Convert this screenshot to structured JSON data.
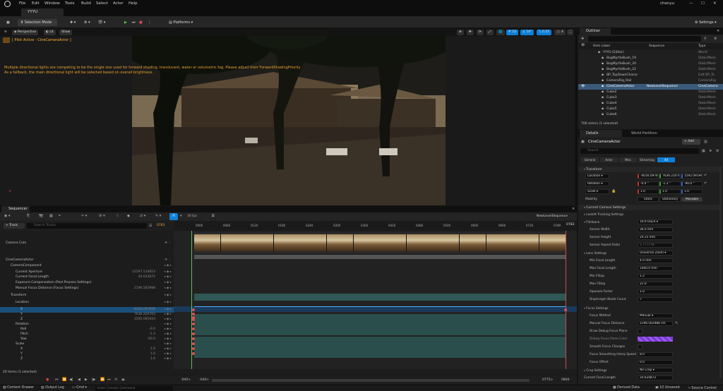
{
  "menubar": {
    "items": [
      "File",
      "Edit",
      "Window",
      "Tools",
      "Build",
      "Select",
      "Actor",
      "Help"
    ],
    "user": "chenyu",
    "project_tab": "YYYU"
  },
  "toolbar": {
    "selection_mode": "Selection Mode",
    "platforms": "Platforms",
    "settings": "Settings"
  },
  "viewport": {
    "perspective": "Perspective",
    "lit": "Lit",
    "show": "Show",
    "pilot_label": "[ Pilot Active - CineCameraActor ]",
    "warning_text": "Multiple directional lights are competing to be the single one used for forward shading, translucent, water or volumetric fog. Please adjust their ForwardShadingPriority",
    "fallback_text": "As a fallback, the main directional light will be selected based on overall brightness.",
    "snap_grid": "10",
    "snap_rot": "10°",
    "snap_scale": "0.25",
    "cam_speed": "4"
  },
  "sequencer": {
    "tab": "Sequencer",
    "track_button": "+ Track",
    "search_placeholder": "Search Tracks",
    "current_frame": "0783",
    "fps": "30 fps",
    "sequence_name": "NewLevelSequence",
    "sequence_frame": "0783",
    "rows": [
      {
        "label": "Camera Cuts",
        "indent": 0,
        "value": ""
      },
      {
        "label": "CineCameraActor",
        "indent": 0,
        "value": ""
      },
      {
        "label": "CameraComponent",
        "indent": 1,
        "value": ""
      },
      {
        "label": "Current Aperture",
        "indent": 2,
        "value": "12597.516853"
      },
      {
        "label": "Current Focal Length",
        "indent": 2,
        "value": "20.624872"
      },
      {
        "label": "Exposure Compensation (Post Process Settings)",
        "indent": 2,
        "value": ""
      },
      {
        "label": "Manual Focus Distance (Focus Settings)",
        "indent": 2,
        "value": "2196.562988"
      },
      {
        "label": "Transform",
        "indent": 1,
        "value": ""
      },
      {
        "label": "Location",
        "indent": 2,
        "value": ""
      },
      {
        "label": "X",
        "indent": 3,
        "value": "-4016.097656"
      },
      {
        "label": "Y",
        "indent": 3,
        "value": "7636.220703"
      },
      {
        "label": "Z",
        "indent": 3,
        "value": "1592.091943"
      },
      {
        "label": "Rotation",
        "indent": 2,
        "value": ""
      },
      {
        "label": "Roll",
        "indent": 3,
        "value": "-0.0"
      },
      {
        "label": "Pitch",
        "indent": 3,
        "value": "-1.3"
      },
      {
        "label": "Yaw",
        "indent": 3,
        "value": "-90.0"
      },
      {
        "label": "Scale",
        "indent": 2,
        "value": ""
      },
      {
        "label": "X",
        "indent": 3,
        "value": "1.0"
      },
      {
        "label": "Y",
        "indent": 3,
        "value": "1.0"
      },
      {
        "label": "Z",
        "indent": 3,
        "value": "1.0"
      }
    ],
    "items_count": "20 items (1 selected)",
    "ticks": [
      "0000",
      "0060",
      "0120",
      "0180",
      "0240",
      "0300",
      "0360",
      "0420",
      "0480",
      "0540",
      "0600",
      "0660",
      "0720",
      "0780"
    ],
    "range_start": "-040>",
    "range_start2": "-040>",
    "range_end": "0775>",
    "range_end2": "0800"
  },
  "outliner": {
    "title": "Outliner",
    "col_label": "Item Label",
    "col_sequence": "Sequence",
    "col_type": "Type",
    "items": [
      {
        "label": "YYYU (Editor)",
        "sequence": "",
        "type": "World",
        "selected": false
      },
      {
        "label": "BogMyrtleBush_19",
        "sequence": "",
        "type": "StaticMesh",
        "selected": false
      },
      {
        "label": "BogMyrtleBush_20",
        "sequence": "",
        "type": "StaticMesh",
        "selected": false
      },
      {
        "label": "BogMyrtleBush_21",
        "sequence": "",
        "type": "StaticMesh",
        "selected": false
      },
      {
        "label": "BP_TopDownCharac",
        "sequence": "",
        "type": "Edit BP_To",
        "selected": false
      },
      {
        "label": "CameraRig_Rail",
        "sequence": "",
        "type": "CameraRig",
        "selected": false
      },
      {
        "label": "CineCameraActor",
        "sequence": "NewLevelSequence",
        "type": "CineCamera",
        "selected": true
      },
      {
        "label": "Cube2",
        "sequence": "",
        "type": "StaticMesh",
        "selected": false
      },
      {
        "label": "Cube3",
        "sequence": "",
        "type": "StaticMesh",
        "selected": false
      },
      {
        "label": "Cube4",
        "sequence": "",
        "type": "StaticMesh",
        "selected": false
      },
      {
        "label": "Cube5",
        "sequence": "",
        "type": "StaticMesh",
        "selected": false
      },
      {
        "label": "Cube6",
        "sequence": "",
        "type": "StaticMesh",
        "selected": false
      }
    ],
    "actor_count": "706 actors (1 selected)"
  },
  "details": {
    "tab": "Details",
    "tab2": "World Partition",
    "actor_name": "CineCameraActor",
    "add_label": "+ Add",
    "search_placeholder": "Search",
    "filters": [
      "General",
      "Actor",
      "Misc",
      "Streaming",
      "All"
    ],
    "transform_title": "Transform",
    "location_label": "Location",
    "location": [
      "-4016.09765",
      "7636.22070",
      "1592.09194"
    ],
    "rotation_label": "Rotation",
    "rotation": [
      "-0.0 °",
      "-1.3 °",
      "-90.0 °"
    ],
    "scale_label": "Scale",
    "scale": [
      "1.0",
      "1.0",
      "1.0"
    ],
    "mobility_label": "Mobility",
    "mobility": [
      "Static",
      "Stationary",
      "Movable"
    ],
    "camera_settings_title": "Current Camera Settings",
    "lookat_title": "LookAt Tracking Settings",
    "filmback_label": "Filmback",
    "filmback_value": "16:9 DSLR",
    "sensor_width_label": "Sensor Width",
    "sensor_width": "36.0 mm",
    "sensor_height_label": "Sensor Height",
    "sensor_height": "20.25 mm",
    "sensor_aspect_label": "Sensor Aspect Ratio",
    "sensor_aspect": "1.777778",
    "lens_label": "Lens Settings",
    "lens_value": "Universal Zoom",
    "min_focal_label": "Min Focal Length",
    "min_focal": "4.0 mm",
    "max_focal_label": "Max Focal Length",
    "max_focal": "1000.0 mm",
    "min_fstop_label": "Min FStop",
    "min_fstop": "1.2",
    "max_fstop_label": "Max FStop",
    "max_fstop": "22.0",
    "squeeze_label": "Squeeze Factor",
    "squeeze": "1.0",
    "blades_label": "Diaphragm Blade Count",
    "blades": "7",
    "focus_title": "Focus Settings",
    "focus_method_label": "Focus Method",
    "focus_method": "Manual",
    "manual_focus_label": "Manual Focus Distance",
    "manual_focus": "2196.562988 cm",
    "draw_debug_label": "Draw Debug Focus Plane",
    "debug_color_label": "Debug Focus Plane Color",
    "smooth_focus_label": "Smooth Focus Changes",
    "smoothing_speed_label": "Focus Smoothing Interp Speed",
    "smoothing_speed": "8.0",
    "focus_offset_label": "Focus Offset",
    "focus_offset": "0.0",
    "crop_label": "Crop Settings",
    "crop_value": "No Crop",
    "current_focal_label": "Current Focal Length",
    "current_focal": "20.624872"
  },
  "statusbar": {
    "content_drawer": "Content Drawer",
    "output_log": "Output Log",
    "cmd": "Cmd",
    "console_placeholder": "Enter Console Command",
    "derived": "Derived Data",
    "unsaved": "10 Unsaved",
    "source": "Source Control"
  },
  "colors": {
    "accent": "#0e7fd6",
    "keyframe": "#e05050",
    "selection": "#1a4f7a",
    "track_teal": "#2f5755"
  }
}
